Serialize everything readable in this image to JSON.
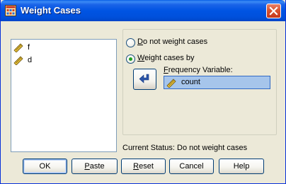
{
  "window": {
    "title": "Weight Cases",
    "app_icon": "spss-dialog-icon",
    "close_icon": "close-icon"
  },
  "variables": [
    {
      "name": "f",
      "icon": "ruler-scale-icon"
    },
    {
      "name": "d",
      "icon": "ruler-scale-icon"
    }
  ],
  "options": {
    "no_weight": {
      "mnemonic": "D",
      "rest": "o not weight cases",
      "selected": false
    },
    "weight_by": {
      "mnemonic": "W",
      "rest": "eight cases by",
      "selected": true
    }
  },
  "move_icon": "move-arrow-icon",
  "frequency": {
    "mnemonic": "F",
    "rest": "requency Variable:",
    "value": "count",
    "icon": "ruler-scale-icon"
  },
  "status_text": "Current Status: Do not weight cases",
  "buttons": {
    "ok": {
      "label": "OK"
    },
    "paste": {
      "mnemonic": "P",
      "rest": "aste"
    },
    "reset": {
      "mnemonic": "R",
      "rest": "eset"
    },
    "cancel": {
      "label": "Cancel"
    },
    "help": {
      "label": "Help"
    }
  },
  "colors": {
    "title_bar": "#0054e3",
    "radio_dot": "#21a121",
    "selection": "#a6c5eb"
  }
}
